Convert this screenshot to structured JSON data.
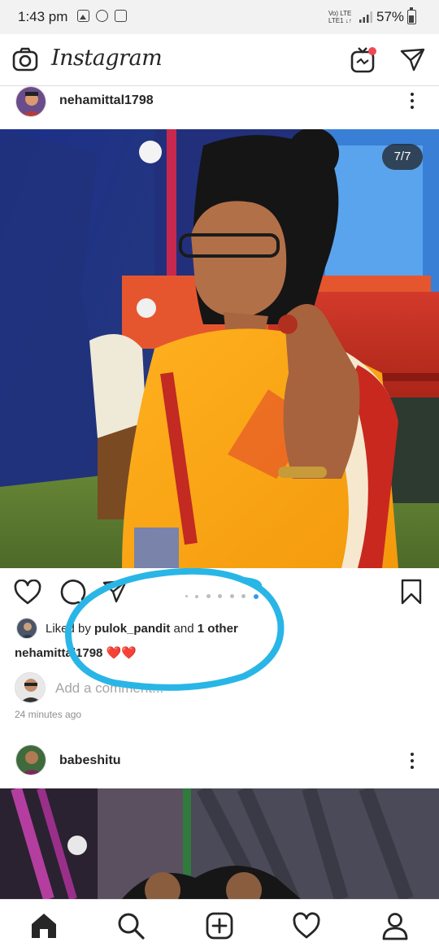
{
  "status_bar": {
    "time": "1:43 pm",
    "network_top": "Vo) LTE",
    "network_bottom": "LTE1 ↓↑",
    "battery": "57%",
    "icons": [
      "gallery-icon",
      "whatsapp-icon",
      "app-icon",
      "signal-icon",
      "battery-icon"
    ]
  },
  "header": {
    "app_name": "Instagram",
    "icons": [
      "camera-icon",
      "igtv-icon",
      "direct-message-icon"
    ],
    "igtv_badge_color": "#ed4956"
  },
  "posts": [
    {
      "username": "nehamittal1798",
      "media_counter": "7/7",
      "pager": {
        "total": 7,
        "current": 7
      },
      "liked_by_prefix": "Liked by ",
      "liked_by_user": "pulok_pandit",
      "liked_by_suffix": " and ",
      "liked_by_others": "1 other",
      "caption_user": "nehamittal1798",
      "caption_text": " ❤️❤️",
      "comment_placeholder": "Add a comment...",
      "timestamp": "24 minutes ago"
    },
    {
      "username": "babeshitu"
    }
  ],
  "annotation_color": "#29b6e6",
  "accent": "#3897f0",
  "bottom_nav": {
    "items": [
      "home-icon",
      "search-icon",
      "new-post-icon",
      "activity-icon",
      "profile-icon"
    ]
  }
}
